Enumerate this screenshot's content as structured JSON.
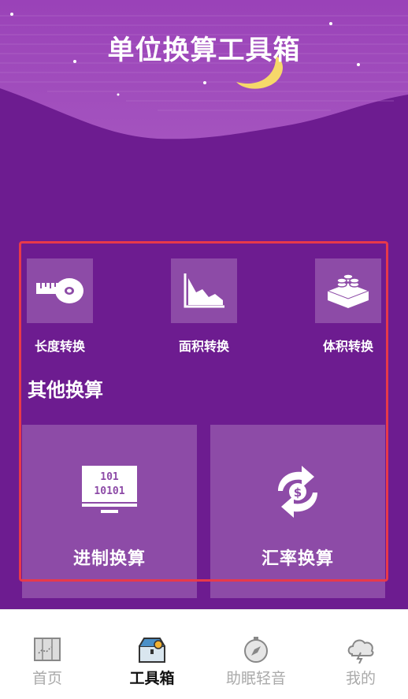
{
  "header": {
    "title": "单位换算工具箱"
  },
  "converters": [
    {
      "label": "长度转换",
      "icon": "tape-measure-icon"
    },
    {
      "label": "面积转换",
      "icon": "area-chart-icon"
    },
    {
      "label": "体积转换",
      "icon": "volume-blocks-icon"
    }
  ],
  "other_section": {
    "title": "其他换算",
    "cards": [
      {
        "label": "进制换算",
        "icon": "binary-monitor-icon"
      },
      {
        "label": "汇率换算",
        "icon": "currency-exchange-icon"
      }
    ]
  },
  "tabbar": {
    "tabs": [
      {
        "label": "首页",
        "icon": "map-icon",
        "active": false
      },
      {
        "label": "工具箱",
        "icon": "toolbox-icon",
        "active": true
      },
      {
        "label": "助眠轻音",
        "icon": "compass-icon",
        "active": false
      },
      {
        "label": "我的",
        "icon": "storm-cloud-icon",
        "active": false
      }
    ]
  },
  "colors": {
    "background": "#6d1c90",
    "tile": "#8d4ba7",
    "highlight": "#e8394a",
    "moon": "#f6d86a"
  }
}
